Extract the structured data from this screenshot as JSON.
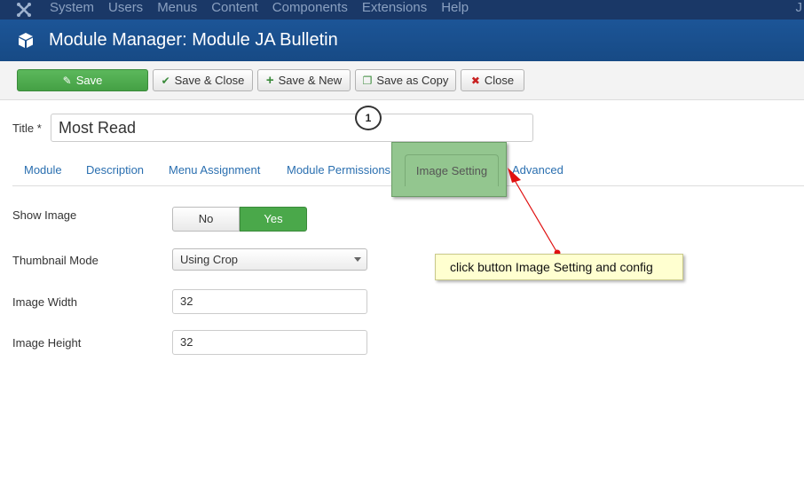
{
  "topmenu": {
    "items": [
      "System",
      "Users",
      "Menus",
      "Content",
      "Components",
      "Extensions",
      "Help"
    ],
    "user_initial": "J"
  },
  "header": {
    "title": "Module Manager: Module JA Bulletin"
  },
  "toolbar": {
    "save": "Save",
    "save_close": "Save & Close",
    "save_new": "Save & New",
    "save_copy": "Save as Copy",
    "close": "Close"
  },
  "title_field": {
    "label": "Title *",
    "value": "Most Read"
  },
  "tabs": [
    "Module",
    "Description",
    "Menu Assignment",
    "Module Permissions",
    "Image Setting",
    "Advanced"
  ],
  "form": {
    "show_image": {
      "label": "Show Image",
      "off": "No",
      "on": "Yes"
    },
    "thumbnail_mode": {
      "label": "Thumbnail Mode",
      "value": "Using Crop"
    },
    "image_width": {
      "label": "Image Width",
      "value": "32"
    },
    "image_height": {
      "label": "Image Height",
      "value": "32"
    }
  },
  "annotation": {
    "step": "1",
    "callout": "click button Image Setting and config"
  },
  "colors": {
    "topbar": "#1a3867",
    "header": "#1c5597",
    "save_green": "#4aa84a",
    "link_blue": "#2a6fb0",
    "highlight": "#93c68f",
    "callout_bg": "#ffffd0",
    "arrow_red": "#e01010"
  }
}
